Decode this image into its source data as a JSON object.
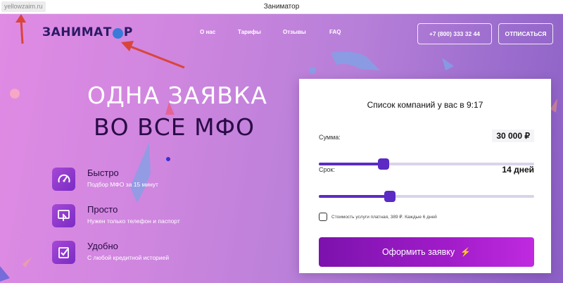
{
  "browser": {
    "url": "yellowzaim.ru",
    "window_title": "Заниматор"
  },
  "header": {
    "logo_text_start": "ЗАНИМАТ",
    "logo_text_end": "Р",
    "nav": [
      {
        "label": "О нас"
      },
      {
        "label": "Тарифы"
      },
      {
        "label": "Отзывы"
      },
      {
        "label": "FAQ"
      }
    ],
    "phone": "+7 (800) 333 32 44",
    "signin_label": "ОТПИСАТЬСЯ"
  },
  "hero": {
    "headline_line1": "ОДНА ЗАЯВКА",
    "headline_line2": "ВО ВСЕ МФО",
    "features": [
      {
        "title": "Быстро",
        "subtitle": "Подбор МФО за 15 минут",
        "icon": "speedometer-icon"
      },
      {
        "title": "Просто",
        "subtitle": "Нужен только телефон и паспорт",
        "icon": "touch-screen-icon"
      },
      {
        "title": "Удобно",
        "subtitle": "С любой кредитной историей",
        "icon": "checklist-icon"
      }
    ]
  },
  "form": {
    "title": "Список компаний у вас в 9:17",
    "amount_label": "Сумма:",
    "amount_value": "30 000 ₽",
    "amount_fraction": 0.3,
    "term_label": "Срок:",
    "term_value": "14 дней",
    "term_fraction": 0.33,
    "consent_text": "Стоимость услуги платная, 389 ₽. Каждые 6 дней",
    "consent_checked": false,
    "submit_label": "Оформить заявку",
    "submit_icon": "⚡"
  },
  "colors": {
    "accent": "#5b2bc4",
    "button": "#a11cc9",
    "headline_dark": "#2a0b47",
    "annotation_arrow": "#d9453a"
  }
}
